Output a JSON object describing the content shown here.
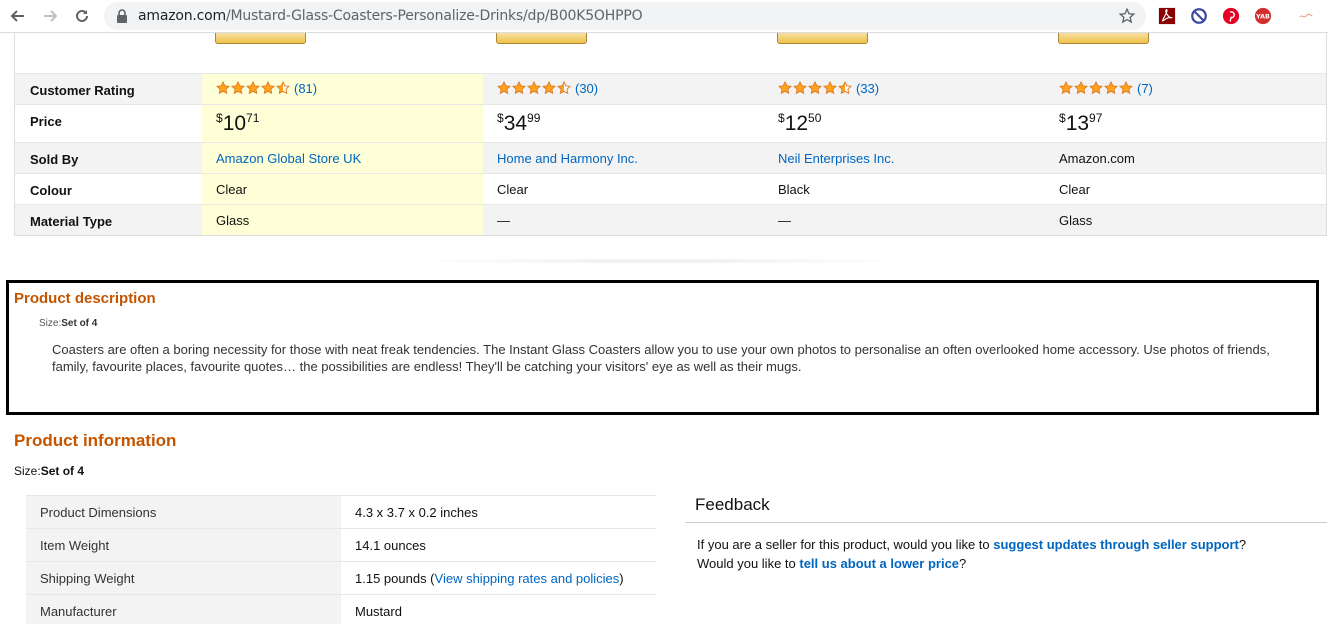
{
  "browser": {
    "url_host": "amazon.com",
    "url_path": "/Mustard-Glass-Coasters-Personalize-Drinks/dp/B00K5OHPPO"
  },
  "colors": {
    "accent_orange": "#c45500",
    "link_blue": "#0066c0",
    "highlight": "#fefed7",
    "star": "#ffa41c"
  },
  "comparison": {
    "labels": {
      "rating": "Customer Rating",
      "price": "Price",
      "sold_by": "Sold By",
      "colour": "Colour",
      "material": "Material Type"
    },
    "products": [
      {
        "stars": 4.5,
        "reviews": "(81)",
        "price_symbol": "$",
        "price_whole": "10",
        "price_fraction": "71",
        "sold_by": "Amazon Global Store UK",
        "sold_by_link": true,
        "colour": "Clear",
        "material": "Glass"
      },
      {
        "stars": 4.5,
        "reviews": "(30)",
        "price_symbol": "$",
        "price_whole": "34",
        "price_fraction": "99",
        "sold_by": "Home and Harmony Inc.",
        "sold_by_link": true,
        "colour": "Clear",
        "material": "—"
      },
      {
        "stars": 4.5,
        "reviews": "(33)",
        "price_symbol": "$",
        "price_whole": "12",
        "price_fraction": "50",
        "sold_by": "Neil Enterprises Inc.",
        "sold_by_link": true,
        "colour": "Black",
        "material": "—"
      },
      {
        "stars": 5,
        "reviews": "(7)",
        "price_symbol": "$",
        "price_whole": "13",
        "price_fraction": "97",
        "sold_by": "Amazon.com",
        "sold_by_link": false,
        "colour": "Clear",
        "material": "Glass"
      }
    ]
  },
  "description": {
    "heading": "Product description",
    "size_label": "Size:",
    "size_value": "Set of 4",
    "text": "Coasters are often a boring necessity for those with neat freak tendencies. The Instant Glass Coasters allow you to use your own photos to personalise an often overlooked home accessory. Use photos of friends, family, favourite places, favourite quotes… the possibilities are endless! They'll be catching your visitors' eye as well as their mugs."
  },
  "information": {
    "heading": "Product information",
    "size_label": "Size:",
    "size_value": "Set of 4",
    "rows": [
      {
        "label": "Product Dimensions",
        "value": "4.3 x 3.7 x 0.2 inches"
      },
      {
        "label": "Item Weight",
        "value": "14.1 ounces"
      },
      {
        "label": "Shipping Weight",
        "value": "1.15 pounds (",
        "link": "View shipping rates and policies",
        "after": ")"
      },
      {
        "label": "Manufacturer",
        "value": "Mustard"
      }
    ]
  },
  "feedback": {
    "title": "Feedback",
    "line1_pre": "If you are a seller for this product, would you like to ",
    "line1_link": "suggest updates through seller support",
    "line1_post": "?",
    "line2_pre": "Would you like to ",
    "line2_link": "tell us about a lower price",
    "line2_post": "?"
  }
}
